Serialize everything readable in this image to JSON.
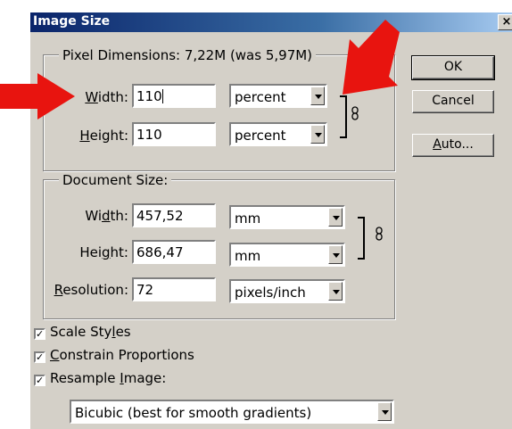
{
  "dialog": {
    "title": "Image Size",
    "close_glyph": "×"
  },
  "pixel_dimensions": {
    "legend": "Pixel Dimensions:  7,22M (was 5,97M)",
    "width_label_pre": "",
    "width_label_u": "W",
    "width_label_post": "idth:",
    "width_value": "110",
    "width_unit": "percent",
    "height_label_pre": "",
    "height_label_u": "H",
    "height_label_post": "eight:",
    "height_value": "110",
    "height_unit": "percent",
    "link_icon": "chain-link-icon"
  },
  "document_size": {
    "legend": "Document Size:",
    "width_label_pre": "Wi",
    "width_label_u": "d",
    "width_label_post": "th:",
    "width_value": "457,52",
    "width_unit": "mm",
    "height_label_pre": "Hei",
    "height_label_u": "g",
    "height_label_post": "ht:",
    "height_value": "686,47",
    "height_unit": "mm",
    "resolution_label_pre": "",
    "resolution_label_u": "R",
    "resolution_label_post": "esolution:",
    "resolution_value": "72",
    "resolution_unit": "pixels/inch",
    "link_icon": "chain-link-icon"
  },
  "buttons": {
    "ok": "OK",
    "cancel": "Cancel",
    "auto_u": "A",
    "auto_rest": "uto..."
  },
  "options": {
    "scale_styles": {
      "pre": "Scale Sty",
      "u": "l",
      "post": "es",
      "checked": true
    },
    "constrain": {
      "pre": "",
      "u": "C",
      "post": "onstrain Proportions",
      "checked": true
    },
    "resample": {
      "pre": "Resample ",
      "u": "I",
      "post": "mage:",
      "checked": true
    },
    "check_glyph": "✓",
    "resample_method": "Bicubic (best for smooth gradients)"
  },
  "annotations": {
    "arrow_color": "#e8140f",
    "arrows": [
      "red-arrow-left",
      "red-arrow-top"
    ]
  }
}
